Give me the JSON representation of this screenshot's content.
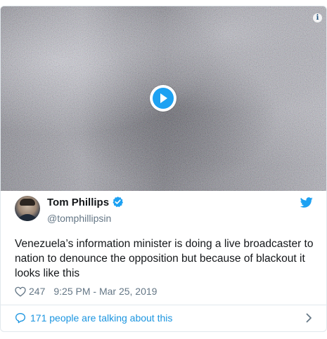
{
  "media": {
    "play_icon": "play-circle-icon",
    "info_icon": "info-icon",
    "info_glyph": "i"
  },
  "author": {
    "display_name": "Tom Phillips",
    "handle": "@tomphillipsin",
    "verified": true,
    "verified_icon": "verified-badge-icon",
    "avatar": "avatar"
  },
  "brand": {
    "icon": "twitter-bird-icon",
    "color": "#1da1f2"
  },
  "tweet": {
    "text": "Venezuela’s information minister is doing a live broadcaster to nation to denounce the opposition but because of blackout it looks like this",
    "like_icon": "heart-icon",
    "like_count": "247",
    "timestamp": "9:25 PM - Mar 25, 2019"
  },
  "conversation": {
    "icon": "speech-bubble-icon",
    "label": "171 people are talking about this",
    "chevron_icon": "chevron-right-icon",
    "link_color": "#1b95e0"
  }
}
